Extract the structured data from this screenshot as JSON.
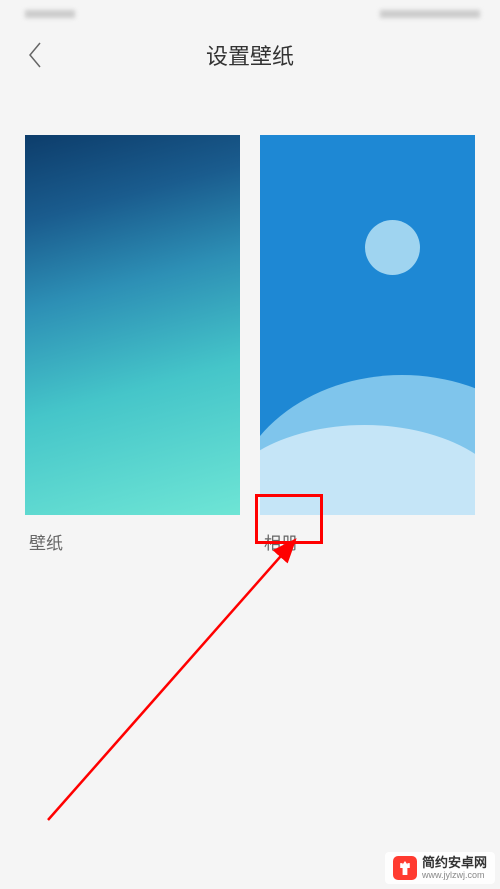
{
  "header": {
    "title": "设置壁纸"
  },
  "options": {
    "wallpaper": {
      "label": "壁纸"
    },
    "album": {
      "label": "相册"
    }
  },
  "watermark": {
    "title": "简约安卓网",
    "url": "www.jylzwj.com"
  }
}
